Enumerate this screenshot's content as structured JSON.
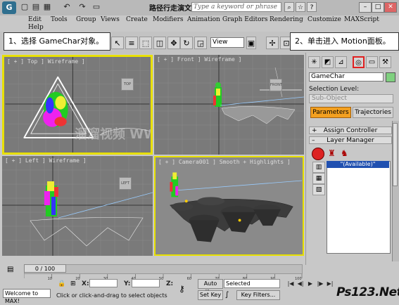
{
  "title_bar": {
    "app_icon": "3dsmax-logo",
    "document_title": "路径行走演文件.max",
    "search_placeholder": "Type a keyword or phrase",
    "quick_access_icons": [
      "new-icon",
      "open-icon",
      "save-icon",
      "undo-icon",
      "redo-icon"
    ],
    "window_buttons": [
      "minimize",
      "maximize",
      "close"
    ]
  },
  "menu": {
    "items": [
      "Edit",
      "Tools",
      "Group",
      "Views",
      "Create",
      "Modifiers",
      "Animation",
      "Graph Editors",
      "Rendering",
      "Customize",
      "MAXScript"
    ],
    "help": "Help"
  },
  "toolbar": {
    "view_dropdown": "View"
  },
  "callouts": {
    "step1": "1、选择 GameChar对象。",
    "step2": "2、单击进入 Motion面板。"
  },
  "viewports": {
    "top": "[ + ] Top ] Wireframe ]",
    "front": "[ + ] Front ] Wireframe ]",
    "left": "[ + ] Left ] Wireframe ]",
    "camera": "[ + ] Camera001 ] Smooth + Highlights ]",
    "watermark": "溜溜视频 WWW.TLVNET.NET",
    "cube_top": "TOP",
    "cube_front": "FRONT",
    "cube_left": "LEFT"
  },
  "command_panel": {
    "tabs": [
      "create-icon",
      "modify-icon",
      "hierarchy-icon",
      "motion-icon",
      "display-icon",
      "utilities-icon"
    ],
    "object_name": "GameChar",
    "object_color": "#7fd07f",
    "selection_level_label": "Selection Level:",
    "sub_object": "Sub-Object",
    "tab_parameters": "Parameters",
    "tab_trajectories": "Trajectories",
    "rollout_assign": "Assign Controller",
    "rollout_layer": "Layer Manager",
    "layer_available": "\"(Available)\""
  },
  "timeline": {
    "frame_display": "0 / 100",
    "ruler_ticks": [
      "0",
      "10",
      "20",
      "30",
      "40",
      "50",
      "60",
      "70",
      "80",
      "90",
      "100"
    ]
  },
  "status": {
    "maxscript_text": "Welcome to MAX!",
    "prompt": "Click or click-and-drag to select objects",
    "x_label": "X:",
    "y_label": "Y:",
    "z_label": "Z:",
    "auto_key": "Auto Key",
    "set_key": "Set Key",
    "key_mode": "Selected",
    "key_filters": "Key Filters..."
  },
  "watermark_brand": "Ps123.Net"
}
